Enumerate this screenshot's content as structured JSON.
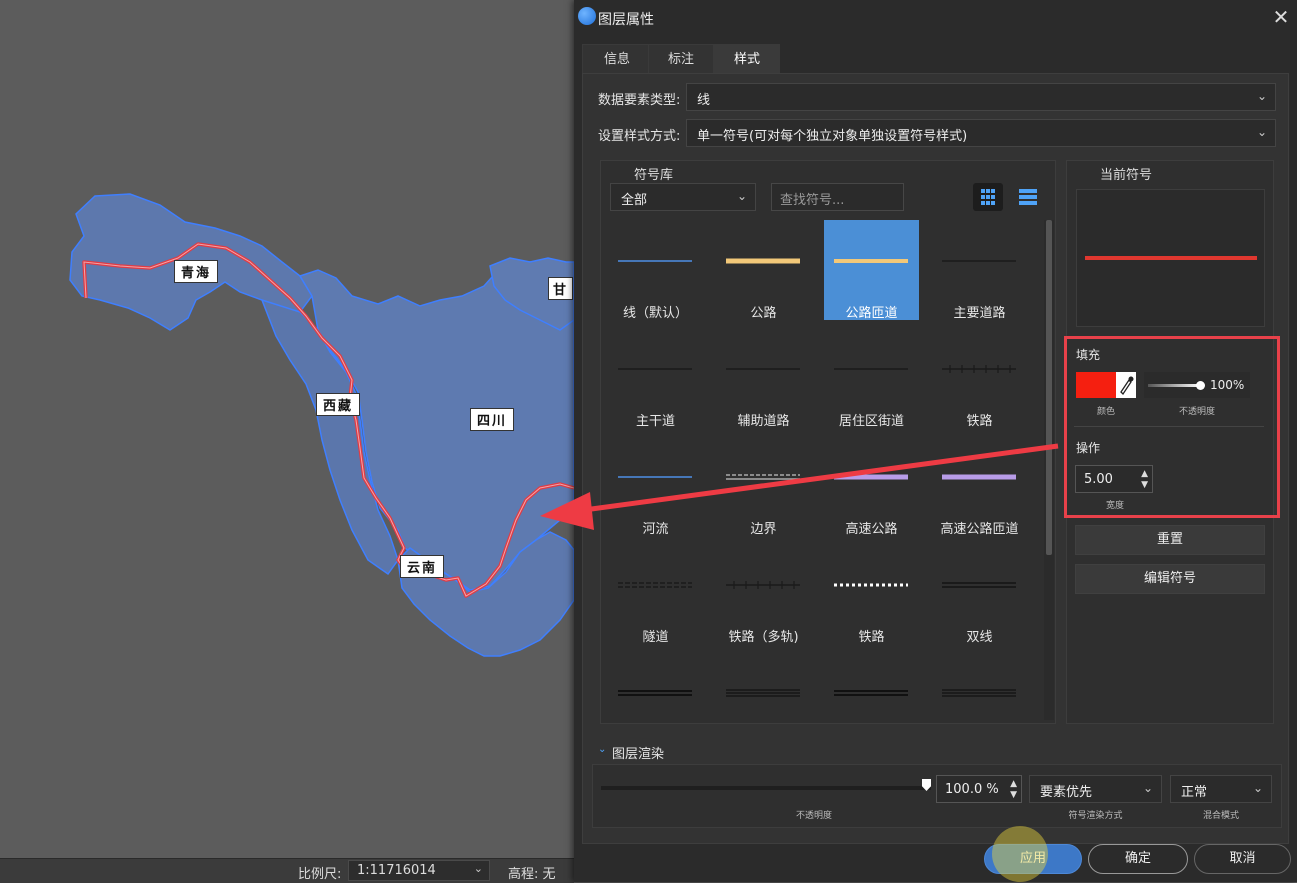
{
  "map": {
    "labels": {
      "qinghai": "青海",
      "xizang": "西藏",
      "sichuan": "四川",
      "yunnan": "云南",
      "gansu": "甘"
    },
    "colors": {
      "region_fill": "#5d78ad",
      "region_stroke": "#3f7fff",
      "route": "#e03c45",
      "arrow": "#ee3b44"
    }
  },
  "statusbar": {
    "scale_label": "比例尺:",
    "scale_value": "1:11716014",
    "elevation": "高程: 无"
  },
  "dialog": {
    "title": "图层属性",
    "close_icon": "close-icon",
    "tabs": [
      {
        "label": "信息"
      },
      {
        "label": "标注"
      },
      {
        "label": "样式"
      }
    ],
    "feature_type": {
      "label": "数据要素类型:",
      "value": "线"
    },
    "style_mode": {
      "label": "设置样式方式:",
      "value": "单一符号(可对每个独立对象单独设置符号样式)"
    },
    "symbol_library": {
      "title": "符号库",
      "category": "全部",
      "search_placeholder": "查找符号...",
      "symbols": [
        {
          "name": "线（默认）",
          "style": "thin",
          "color": "#4f8fe6"
        },
        {
          "name": "公路",
          "style": "thick",
          "color": "#f2c879"
        },
        {
          "name": "公路匝道",
          "style": "ramp",
          "color": "#f2c879"
        },
        {
          "name": "主要道路",
          "style": "thin",
          "color": "#1a1a1a"
        },
        {
          "name": "主干道",
          "style": "thin",
          "color": "#1a1a1a"
        },
        {
          "name": "辅助道路",
          "style": "thin",
          "color": "#1a1a1a"
        },
        {
          "name": "居住区街道",
          "style": "thin",
          "color": "#1a1a1a"
        },
        {
          "name": "铁路",
          "style": "rail",
          "color": "#1a1a1a"
        },
        {
          "name": "河流",
          "style": "thin",
          "color": "#4f8fe6"
        },
        {
          "name": "边界",
          "style": "border",
          "color": "#aaaaaa"
        },
        {
          "name": "高速公路",
          "style": "thick",
          "color": "#b89ce8"
        },
        {
          "name": "高速公路匝道",
          "style": "thick",
          "color": "#b89ce8"
        },
        {
          "name": "隧道",
          "style": "dashed",
          "color": "#1a1a1a"
        },
        {
          "name": "铁路（多轨)",
          "style": "rail",
          "color": "#1a1a1a"
        },
        {
          "name": "铁路",
          "style": "dotted",
          "color": "#ffffff"
        },
        {
          "name": "双线",
          "style": "double",
          "color": "#1a1a1a"
        },
        {
          "name": "",
          "style": "double",
          "color": "#111111"
        },
        {
          "name": "",
          "style": "triple",
          "color": "#111111"
        },
        {
          "name": "",
          "style": "double",
          "color": "#111111"
        },
        {
          "name": "",
          "style": "triple",
          "color": "#111111"
        }
      ],
      "selected_index": 2
    },
    "current_symbol": {
      "title": "当前符号",
      "line_color": "#e0372f"
    },
    "fill": {
      "title": "填充",
      "color": "#f51f10",
      "color_caption": "颜色",
      "opacity_value": "100%",
      "opacity_caption": "不透明度"
    },
    "operation": {
      "title": "操作",
      "width_value": "5.00",
      "width_caption": "宽度"
    },
    "reset_button": "重置",
    "edit_symbol_button": "编辑符号",
    "layer_render": {
      "title": "图层渲染",
      "opacity_value": "100.0 %",
      "opacity_caption": "不透明度",
      "symbol_order": "要素优先",
      "symbol_order_caption": "符号渲染方式",
      "blend_mode": "正常",
      "blend_caption": "混合模式"
    },
    "footer": {
      "apply": "应用",
      "ok": "确定",
      "cancel": "取消"
    }
  }
}
